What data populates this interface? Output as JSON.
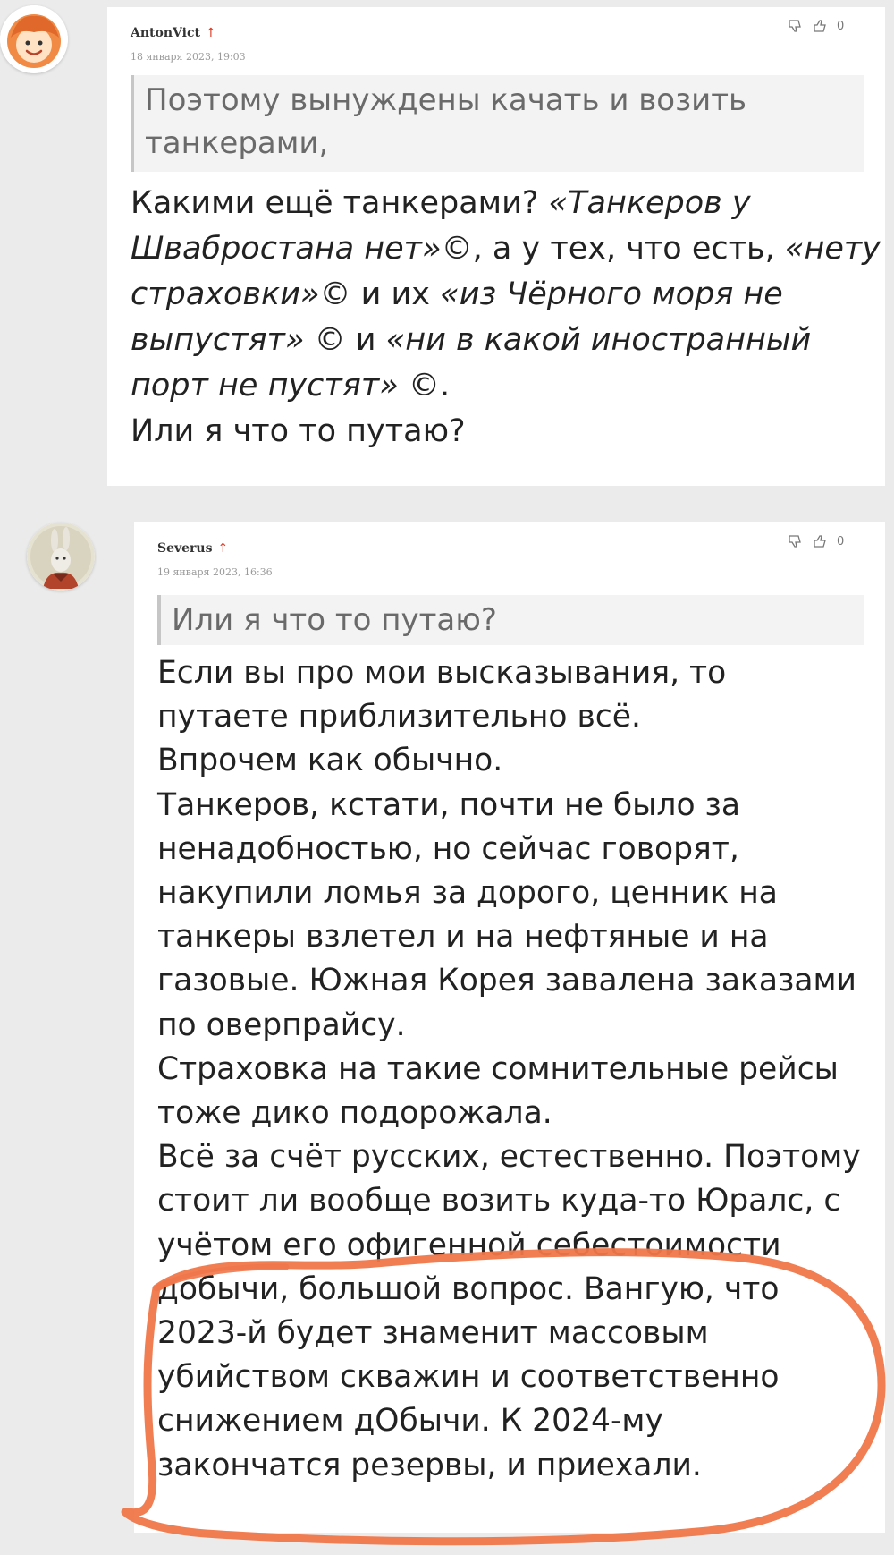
{
  "comments": [
    {
      "author": "AntonVict",
      "rank_icon": "up-arrow-icon",
      "date": "18 января 2023, 19:03",
      "likes": "0",
      "quote_lines": [
        "Поэтому вынуждены качать и возить",
        "танкерами,"
      ],
      "body": {
        "l1a": "Какими ещё танкерами? ",
        "l1b": "«Танкеров у",
        "l2a": "Швабростана нет»",
        "l2b": "©, а у тех, что есть, ",
        "l2c": "«нету",
        "l3a": "страховки»",
        "l3b": "© и их ",
        "l3c": "«из Чёрного моря не",
        "l4a": "выпустят»",
        "l4b": " © и ",
        "l4c": "«ни в какой иностранный",
        "l5a": "порт не пустят»",
        "l5b": " ©.",
        "l6": "Или я что то путаю?"
      }
    },
    {
      "author": "Severus",
      "rank_icon": "up-arrow-icon",
      "date": "19 января 2023, 16:36",
      "likes": "0",
      "quote_lines": [
        "Или я что то путаю?"
      ],
      "body_lines": [
        "Если вы про мои высказывания, то",
        "путаете приблизительно всё.",
        "Впрочем как обычно.",
        "Танкеров, кстати, почти не было за",
        "ненадобностью, но сейчас говорят,",
        "накупили ломья за дорого, ценник на",
        "танкеры взлетел и на нефтяные и на",
        "газовые. Южная Корея завалена заказами",
        "по оверпрайсу.",
        "Страховка на такие сомнительные рейсы",
        "тоже дико подорожала.",
        "Всё за счёт русских, естественно. Поэтому",
        "стоит ли вообще возить куда-то Юралс, с",
        "учётом его офигенной себестоимости",
        "добычи, большой вопрос. Вангую, что",
        "2023-й будет знаменит массовым",
        "убийством скважин и соответственно",
        "снижением дОбычи. К 2024-му",
        "закончатся резервы, и приехали."
      ]
    }
  ],
  "colors": {
    "background": "#ebebeb",
    "card": "#ffffff",
    "rank_arrow": "#d9402b",
    "highlight_marker": "#f0774a"
  }
}
